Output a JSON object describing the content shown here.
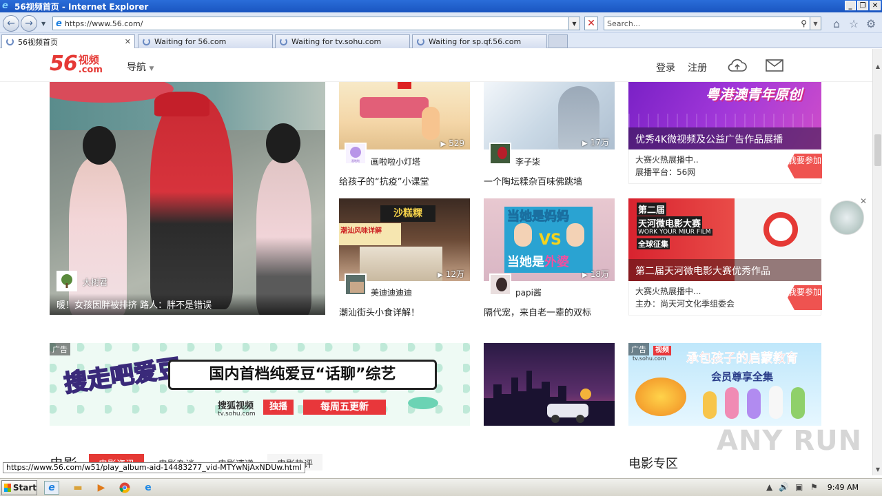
{
  "window": {
    "title": "56视频首页 - Internet Explorer",
    "controls": [
      "_",
      "❐",
      "✕"
    ]
  },
  "addressbar": {
    "url": "https://www.56.com/",
    "search_placeholder": "Search..."
  },
  "tabs": [
    {
      "label": "56视频首页",
      "active": true
    },
    {
      "label": "Waiting for 56.com",
      "active": false
    },
    {
      "label": "Waiting for tv.sohu.com",
      "active": false
    },
    {
      "label": "Waiting for sp.qf.56.com",
      "active": false
    }
  ],
  "site": {
    "logo_num": "56",
    "logo_txt": "视频",
    "logo_dom": ".com",
    "nav_label": "导航",
    "login": "登录",
    "register": "注册"
  },
  "feature": {
    "user": "大树君",
    "title": "暖！女孩因胖被排挤 路人：胖不是错误"
  },
  "videos": [
    {
      "user": "画啦啦小灯塔",
      "count": "529",
      "title": "给孩子的“抗疫”小课堂"
    },
    {
      "user": "李子柒",
      "count": "17万",
      "title": "一个陶坛糅杂百味佛跳墙"
    },
    {
      "user": "美迪迪迪迪",
      "count": "12万",
      "title": "潮汕街头小食详解！"
    },
    {
      "user": "papi酱",
      "count": "18万",
      "title": "隔代宠，来自老一辈的双标"
    }
  ],
  "ads": [
    {
      "overlay": "优秀4K微视频及公益广告作品展播",
      "line1": "大赛火热展播中..",
      "line2": "展播平台：56网",
      "button": "我要参加",
      "img_title": "粤港澳青年原创"
    },
    {
      "overlay": "第二届天河微电影大赛优秀作品",
      "line1": "大赛火热展播中...",
      "line2": "主办：尚天河文化季组委会",
      "button": "我要参加",
      "img_l1": "第二届",
      "img_l2": "天河微电影大赛",
      "img_l3": "WORK YOUR MIUR FILM",
      "img_l4": "全球征集"
    }
  ],
  "banner_ads": [
    {
      "tag": "广告",
      "headline": "国内首档纯爱豆“话聊”综艺",
      "brand": "搜狐视频",
      "badge": "独播",
      "schedule": "每周五更新",
      "domain": "tv.sohu.com",
      "art": "搜走吧爱豆"
    },
    {
      "tag": "广告",
      "headline": "承包孩子的启蒙教育",
      "sub": "会员尊享全集",
      "brand": "视频",
      "domain": "tv.sohu.com"
    }
  ],
  "thumb_texts": {
    "t3_sign": "沙糕粿",
    "t3_text": "潮汕风味详解",
    "t4_top1": "当她是",
    "t4_top2": "妈妈",
    "t4_vs": "VS",
    "t4_bot1": "当她是",
    "t4_bot2": "外婆"
  },
  "section": {
    "title": "电影",
    "tabs": [
      "电影资讯",
      "电影杂谈",
      "电影速递",
      "电影热评"
    ],
    "zone": "电影专区"
  },
  "status_url": "https://www.56.com/w51/play_album-aid-14483277_vid-MTYwNjAxNDUw.html",
  "taskbar": {
    "start": "Start",
    "clock": "9:49 AM"
  },
  "watermark": "ANY RUN",
  "colors": {
    "brand": "#e53935",
    "titlebar": "#1a55c0"
  }
}
